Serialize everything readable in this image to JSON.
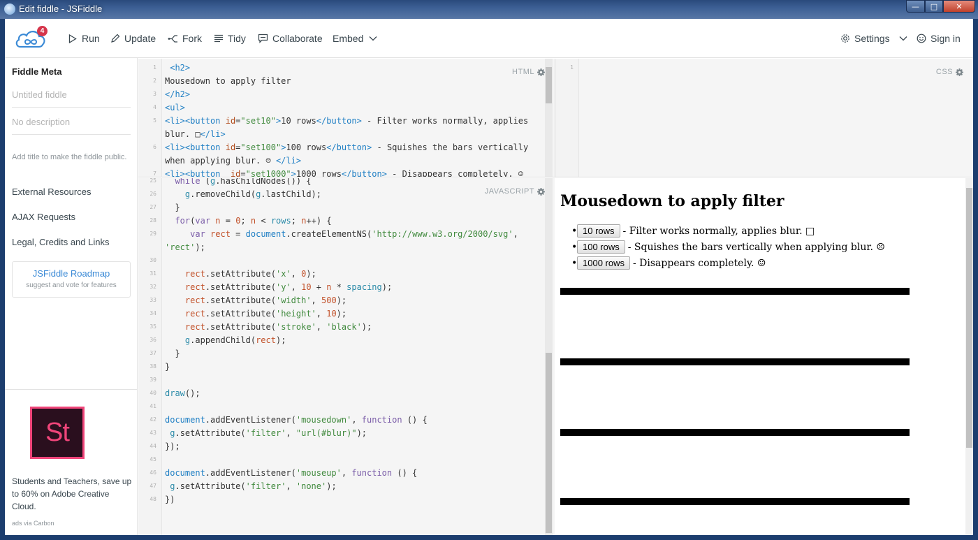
{
  "window": {
    "title": "Edit fiddle - JSFiddle",
    "min": "—",
    "max": "□",
    "close": "✕"
  },
  "toolbar": {
    "badge_count": "4",
    "run": "Run",
    "update": "Update",
    "fork": "Fork",
    "tidy": "Tidy",
    "collaborate": "Collaborate",
    "embed": "Embed",
    "settings": "Settings",
    "sign_in": "Sign in"
  },
  "sidebar": {
    "title": "Fiddle Meta",
    "title_placeholder": "Untitled fiddle",
    "description_placeholder": "No description",
    "hint": "Add title to make the fiddle public.",
    "links": [
      "External Resources",
      "AJAX Requests",
      "Legal, Credits and Links"
    ],
    "roadmap_title": "JSFiddle Roadmap",
    "roadmap_sub": "suggest and vote for features",
    "ad_logo": "St",
    "ad_text": "Students and Teachers, save up to 60% on Adobe Creative Cloud.",
    "ad_via": "ads via Carbon"
  },
  "html_panel": {
    "label": "HTML",
    "line_numbers": [
      "1",
      "2",
      "3",
      "4",
      "5",
      "",
      "6",
      "",
      "7"
    ]
  },
  "css_panel": {
    "label": "CSS",
    "line_numbers": [
      "1"
    ]
  },
  "js_panel": {
    "label": "JAVASCRIPT",
    "line_numbers": [
      "25",
      "26",
      "27",
      "28",
      "29",
      "",
      "30",
      "31",
      "32",
      "33",
      "34",
      "35",
      "36",
      "37",
      "38",
      "39",
      "40",
      "41",
      "42",
      "43",
      "44",
      "45",
      "46",
      "47",
      "48"
    ]
  },
  "result": {
    "heading": "Mousedown to apply filter",
    "items": [
      {
        "button": "10 rows",
        "text": "- Filter works normally, applies blur. □"
      },
      {
        "button": "100 rows",
        "text": "- Squishes the bars vertically when applying blur. ☹"
      },
      {
        "button": "1000 rows",
        "text": "- Disappears completely. ☺"
      }
    ]
  }
}
